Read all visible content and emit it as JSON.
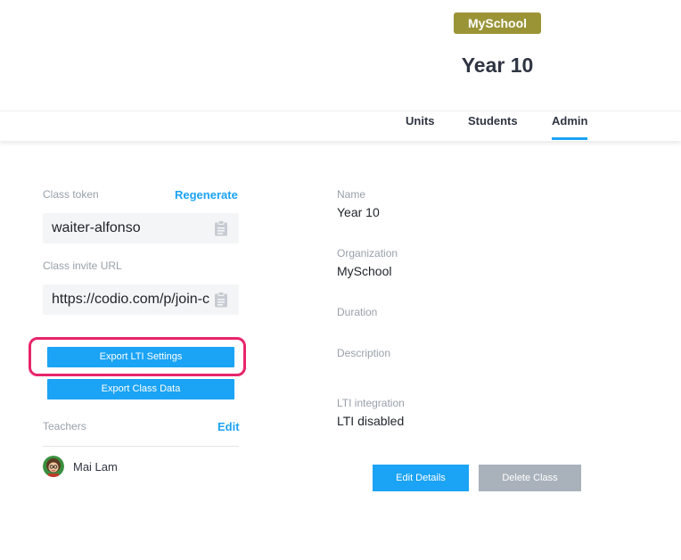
{
  "header": {
    "org_badge": "MySchool",
    "class_title": "Year 10",
    "tabs": [
      {
        "label": "Units",
        "active": false
      },
      {
        "label": "Students",
        "active": false
      },
      {
        "label": "Admin",
        "active": true
      }
    ]
  },
  "left": {
    "class_token_label": "Class token",
    "regenerate_link": "Regenerate",
    "class_token_value": "waiter-alfonso",
    "class_invite_label": "Class invite URL",
    "class_invite_value": "https://codio.com/p/join-class?token=waiter-alfonso",
    "export_lti_button": "Export LTI Settings",
    "export_class_button": "Export Class Data",
    "teachers_label": "Teachers",
    "teachers_edit_link": "Edit",
    "teachers": [
      {
        "name": "Mai Lam"
      }
    ]
  },
  "details": {
    "name_label": "Name",
    "name_value": "Year 10",
    "organization_label": "Organization",
    "organization_value": "MySchool",
    "duration_label": "Duration",
    "duration_value": "",
    "description_label": "Description",
    "description_value": "",
    "lti_label": "LTI integration",
    "lti_value": "LTI disabled"
  },
  "actions": {
    "edit_button": "Edit Details",
    "delete_button": "Delete Class"
  },
  "colors": {
    "accent": "#1ba3f5",
    "badge": "#9b9436",
    "highlight": "#e8246b",
    "disabled_button": "#a9b1bb"
  },
  "icons": {
    "copy": "clipboard-icon"
  }
}
